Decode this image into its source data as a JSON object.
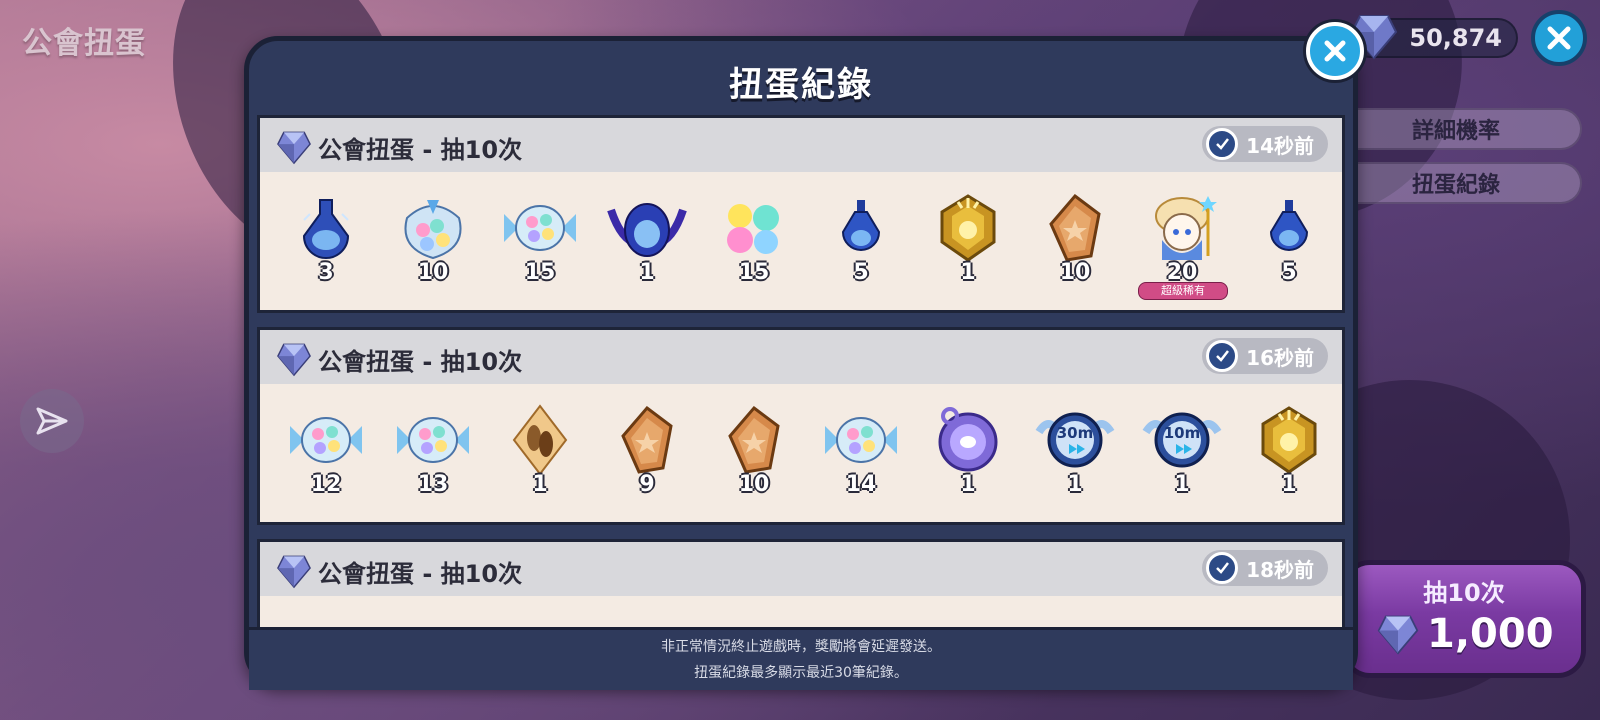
{
  "page": {
    "title": "公會扭蛋"
  },
  "currency": {
    "amount": "50,874",
    "icon": "gem-icon"
  },
  "side_buttons": {
    "details_label": "詳細機率",
    "history_label": "扭蛋紀錄"
  },
  "pull_button": {
    "label": "抽10次",
    "cost": "1,000"
  },
  "modal": {
    "title": "扭蛋紀錄",
    "footer_line1": "非正常情況終止遊戲時，獎勵將會延遲發送。",
    "footer_line2": "扭蛋紀錄最多顯示最近30筆紀錄。"
  },
  "entries": [
    {
      "title": "公會扭蛋 - 抽10次",
      "time": "14秒前",
      "items": [
        {
          "icon": "blue-potion-flask-icon",
          "qty": "3"
        },
        {
          "icon": "candy-bag-icon",
          "qty": "10"
        },
        {
          "icon": "wrapped-candy-icon",
          "qty": "15"
        },
        {
          "icon": "winged-dark-potion-icon",
          "qty": "1"
        },
        {
          "icon": "star-candy-cluster-icon",
          "qty": "15"
        },
        {
          "icon": "small-blue-potion-icon",
          "qty": "5"
        },
        {
          "icon": "gold-emblem-icon",
          "qty": "1"
        },
        {
          "icon": "cookie-tile-icon",
          "qty": "10"
        },
        {
          "icon": "cookie-character-icon",
          "qty": "20",
          "tag": "超級稀有"
        },
        {
          "icon": "small-blue-potion-icon",
          "qty": "5"
        }
      ]
    },
    {
      "title": "公會扭蛋 - 抽10次",
      "time": "16秒前",
      "items": [
        {
          "icon": "wrapped-candy-icon",
          "qty": "12"
        },
        {
          "icon": "wrapped-candy-icon",
          "qty": "13"
        },
        {
          "icon": "seed-tile-icon",
          "qty": "1"
        },
        {
          "icon": "cookie-tile-icon",
          "qty": "9"
        },
        {
          "icon": "cookie-tile-icon",
          "qty": "10"
        },
        {
          "icon": "wrapped-candy-icon",
          "qty": "14"
        },
        {
          "icon": "purple-pocket-watch-icon",
          "qty": "1"
        },
        {
          "icon": "speedup-30m-icon",
          "qty": "1",
          "label": "30m"
        },
        {
          "icon": "speedup-10m-icon",
          "qty": "1",
          "label": "10m"
        },
        {
          "icon": "gold-emblem-icon",
          "qty": "1"
        }
      ]
    },
    {
      "title": "公會扭蛋 - 抽10次",
      "time": "18秒前",
      "items": []
    }
  ],
  "colors": {
    "modal_bg": "#2f3a5c",
    "entry_bg": "#f4ebe3",
    "header_bg": "#d8d8dc",
    "close_blue": "#2aa8e2",
    "pull_purple": "#8a48b2",
    "rare_pink": "#d14c86"
  }
}
